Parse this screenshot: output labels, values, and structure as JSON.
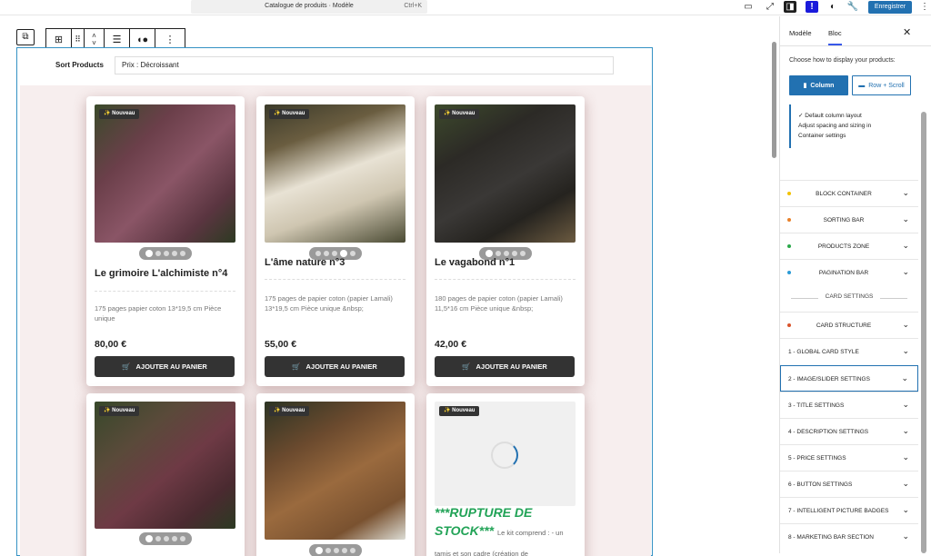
{
  "topbar": {
    "command_title": "Catalogue de produits · Modèle",
    "shortcut": "Ctrl+K",
    "save_label": "Enregistrer"
  },
  "sort": {
    "label": "Sort Products",
    "value": "Prix : Décroissant"
  },
  "badge": "✨ Nouveau",
  "products": [
    {
      "title": "Le grimoire L'alchimiste n°4",
      "desc": "175 pages papier coton 13*19,5 cm Pièce unique",
      "price": "80,00 €",
      "button": "AJOUTER AU PANIER",
      "active_dot": 0
    },
    {
      "title": "L'âme nature n°3",
      "desc": "175 pages de papier coton (papier Lamali) 13*19,5 cm Pièce unique &nbsp;",
      "price": "55,00 €",
      "button": "AJOUTER AU PANIER",
      "active_dot": 3
    },
    {
      "title": "Le vagabond n°1",
      "desc": "180 pages de papier coton (papier Lamali) 11,5*16 cm Pièce unique &nbsp;",
      "price": "42,00 €",
      "button": "AJOUTER AU PANIER",
      "active_dot": 0
    }
  ],
  "product_row2": {
    "rupture_title": "***RUPTURE DE STOCK***",
    "rupture_desc": "Le kit comprend : - un tamis et son cadre (création de"
  },
  "sidebar": {
    "tab_model": "Modèle",
    "tab_block": "Bloc",
    "heading": "Choose how to display your products:",
    "option_column": "Column",
    "option_row": "Row + Scroll",
    "note_line1": "✓ Default column layout",
    "note_line2": "Adjust spacing and sizing in",
    "note_line3": "Container settings",
    "sections": [
      {
        "label": "BLOCK CONTAINER",
        "color": "#f2c200"
      },
      {
        "label": "SORTING BAR",
        "color": "#e8812a"
      },
      {
        "label": "PRODUCTS ZONE",
        "color": "#2aa84a"
      },
      {
        "label": "PAGINATION BAR",
        "color": "#2c9bd6"
      }
    ],
    "card_settings_label": "CARD SETTINGS",
    "card_structure": {
      "label": "CARD STRUCTURE",
      "color": "#d9542b"
    },
    "settings": [
      "1 - GLOBAL CARD STYLE",
      "2 - IMAGE/SLIDER SETTINGS",
      "3 - TITLE SETTINGS",
      "4 - DESCRIPTION SETTINGS",
      "5 - PRICE SETTINGS",
      "6 - BUTTON SETTINGS",
      "7 - INTELLIGENT PICTURE BADGES",
      "8 - MARKETING BAR SECTION"
    ]
  }
}
